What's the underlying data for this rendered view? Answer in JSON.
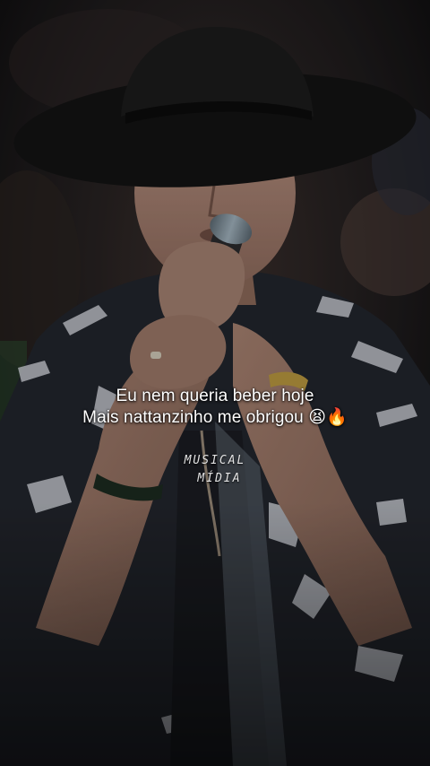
{
  "video": {
    "caption_line_1": "Eu nem queria beber hoje",
    "caption_line_2": "Mais nattanzinho me obrigou 😫🔥",
    "watermark_line_1": "MUSICAL",
    "watermark_line_2": "MÍDIA"
  },
  "colors": {
    "background": "#161616",
    "hat": "#151515",
    "skin": "#a07e6e",
    "shirt_dark": "#22252c",
    "shirt_pattern": "#c9ccd3",
    "microphone": "#7d8c96",
    "caption_text": "#ffffff"
  }
}
